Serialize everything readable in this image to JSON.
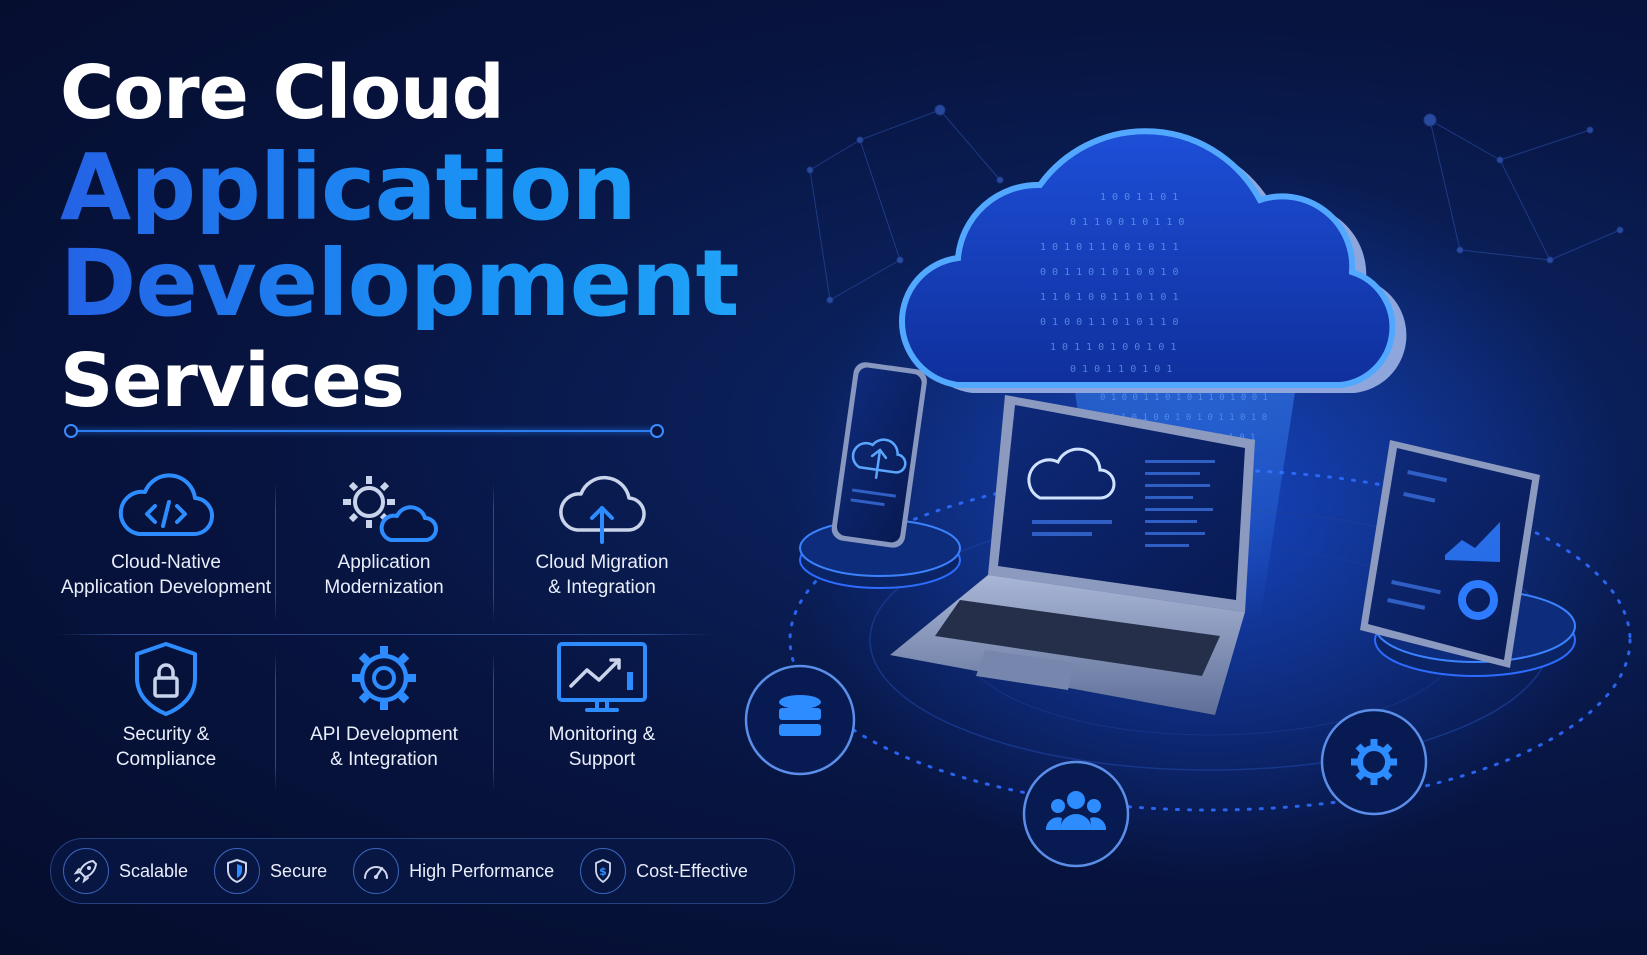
{
  "headline": {
    "line1": "Core Cloud",
    "line2": "Application",
    "line3": "Development",
    "line4": "Services"
  },
  "services": [
    {
      "label": "Cloud-Native\nApplication Development",
      "icon": "cloud-code-icon"
    },
    {
      "label": "Application\nModernization",
      "icon": "gear-cloud-icon"
    },
    {
      "label": "Cloud Migration\n& Integration",
      "icon": "cloud-upload-icon"
    },
    {
      "label": "Security &\nCompliance",
      "icon": "shield-lock-icon"
    },
    {
      "label": "API Development\n& Integration",
      "icon": "gear-icon"
    },
    {
      "label": "Monitoring &\nSupport",
      "icon": "monitor-chart-icon"
    }
  ],
  "benefits": [
    {
      "label": "Scalable",
      "icon": "rocket-icon"
    },
    {
      "label": "Secure",
      "icon": "shield-icon"
    },
    {
      "label": "High Performance",
      "icon": "speedometer-icon"
    },
    {
      "label": "Cost-Effective",
      "icon": "dollar-icon"
    }
  ],
  "colors": {
    "background": "#071440",
    "accent_blue": "#1f8bf2",
    "icon_blue": "#2d8cff",
    "text": "#e9eefb"
  }
}
